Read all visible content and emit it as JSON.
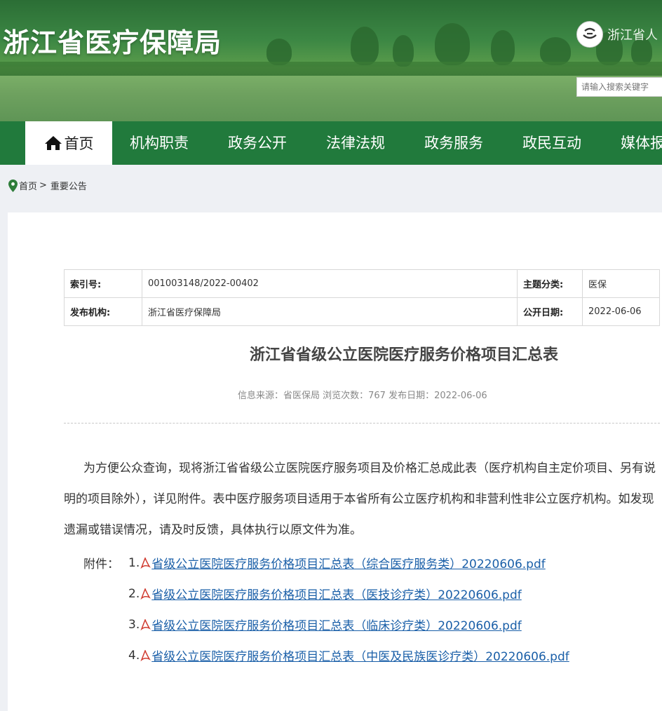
{
  "header": {
    "site_title": "浙江省医疗保障局",
    "gov_text": "浙江省人",
    "search_placeholder": "请输入搜索关键字"
  },
  "nav": {
    "items": [
      {
        "label": "首页"
      },
      {
        "label": "机构职责"
      },
      {
        "label": "政务公开"
      },
      {
        "label": "法律法规"
      },
      {
        "label": "政务服务"
      },
      {
        "label": "政民互动"
      },
      {
        "label": "媒体报"
      }
    ]
  },
  "breadcrumb": {
    "home": "首页",
    "separator": ">",
    "current": "重要公告"
  },
  "meta": {
    "index_label": "索引号:",
    "index_value": "001003148/2022-00402",
    "topic_label": "主题分类:",
    "topic_value": "医保",
    "publisher_label": "发布机构:",
    "publisher_value": "浙江省医疗保障局",
    "date_label": "公开日期:",
    "date_value": "2022-06-06"
  },
  "article": {
    "title": "浙江省省级公立医院医疗服务价格项目汇总表",
    "source_line": "信息来源：省医保局 浏览次数：767 发布日期：2022-06-06",
    "body": "为方便公众查询，现将浙江省省级公立医院医疗服务项目及价格汇总成此表（医疗机构自主定价项目、另有说明的项目除外），详见附件。表中医疗服务项目适用于本省所有公立医疗机构和非营利性非公立医疗机构。如发现遗漏或错误情况，请及时反馈，具体执行以原文件为准。",
    "attachments_label": "附件：",
    "attachments": [
      {
        "num": "1.",
        "name": "省级公立医院医疗服务价格项目汇总表（综合医疗服务类）20220606.pdf"
      },
      {
        "num": "2.",
        "name": "省级公立医院医疗服务价格项目汇总表（医技诊疗类）20220606.pdf"
      },
      {
        "num": "3.",
        "name": "省级公立医院医疗服务价格项目汇总表（临床诊疗类）20220606.pdf"
      },
      {
        "num": "4.",
        "name": "省级公立医院医疗服务价格项目汇总表（中医及民族医诊疗类）20220606.pdf"
      }
    ]
  },
  "colors": {
    "nav_green": "#217a3c",
    "link_blue": "#1a5fa8",
    "pdf_red": "#d03a2f"
  }
}
